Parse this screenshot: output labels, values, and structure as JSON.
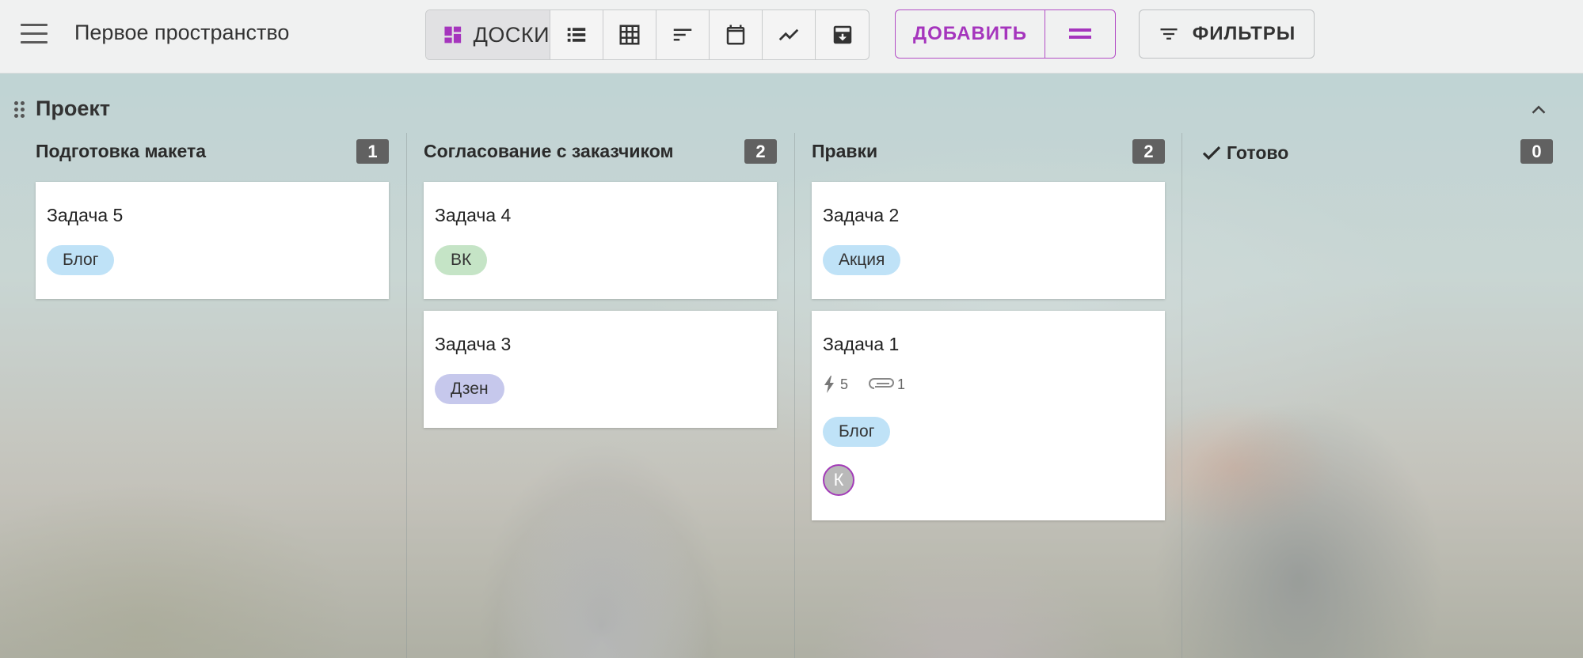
{
  "topbar": {
    "space_title": "Первое пространство",
    "views": [
      {
        "name": "boards",
        "label": "ДОСКИ",
        "icon": "dashboard-icon",
        "active": true
      },
      {
        "name": "list",
        "icon": "list-icon"
      },
      {
        "name": "table",
        "icon": "grid-table-icon"
      },
      {
        "name": "gantt",
        "icon": "gantt-sort-icon"
      },
      {
        "name": "calendar",
        "icon": "calendar-icon"
      },
      {
        "name": "chart",
        "icon": "trend-chart-icon"
      },
      {
        "name": "archive",
        "icon": "archive-icon"
      }
    ],
    "add_label": "ДОБАВИТЬ",
    "filters_label": "ФИЛЬТРЫ",
    "accent_color": "#a535bd"
  },
  "project": {
    "title": "Проект",
    "columns": [
      {
        "title": "Подготовка макета",
        "count": "1",
        "cards": [
          {
            "title": "Задача 5",
            "tags": [
              {
                "label": "Блог",
                "color": "#bfe2f7"
              }
            ]
          }
        ]
      },
      {
        "title": "Согласование с заказчиком",
        "count": "2",
        "cards": [
          {
            "title": "Задача 4",
            "tags": [
              {
                "label": "ВК",
                "color": "#c5e4c6"
              }
            ]
          },
          {
            "title": "Задача 3",
            "tags": [
              {
                "label": "Дзен",
                "color": "#c6c8ec"
              }
            ]
          }
        ]
      },
      {
        "title": "Правки",
        "count": "2",
        "cards": [
          {
            "title": "Задача 2",
            "tags": [
              {
                "label": "Акция",
                "color": "#bfe2f7"
              }
            ]
          },
          {
            "title": "Задача 1",
            "meta": {
              "priority": "5",
              "attachments": "1"
            },
            "tags": [
              {
                "label": "Блог",
                "color": "#bfe2f7"
              }
            ],
            "assignee": "К"
          }
        ]
      },
      {
        "title": "Готово",
        "count": "0",
        "done": true,
        "cards": []
      }
    ]
  }
}
